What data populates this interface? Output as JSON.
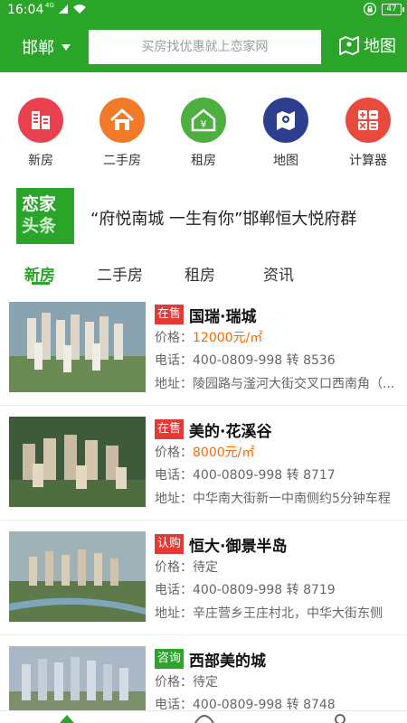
{
  "status_bar": {
    "time": "16:04",
    "network": "4G",
    "battery": "47"
  },
  "header": {
    "city": "邯郸",
    "search_placeholder": "买房找优惠就上恋家网",
    "map_label": "地图"
  },
  "categories": [
    {
      "label": "新房",
      "icon": "building-icon",
      "color": "#e8404f"
    },
    {
      "label": "二手房",
      "icon": "house-icon",
      "color": "#f07a28"
    },
    {
      "label": "租房",
      "icon": "rent-house-icon",
      "color": "#4caf3f"
    },
    {
      "label": "地图",
      "icon": "map-pin-icon",
      "color": "#2d3e8f"
    },
    {
      "label": "计算器",
      "icon": "calculator-icon",
      "color": "#e84a3d"
    }
  ],
  "headline": {
    "logo_line1": "恋家",
    "logo_line2": "头条",
    "text": "“府悦南城 一生有你”邯郸恒大悦府群"
  },
  "tabs": [
    {
      "label": "新房",
      "active": true
    },
    {
      "label": "二手房",
      "active": false
    },
    {
      "label": "租房",
      "active": false
    },
    {
      "label": "资讯",
      "active": false
    }
  ],
  "listings": [
    {
      "status": "在售",
      "status_color": "#e53935",
      "name": "国瑞·瑞城",
      "price_label": "价格：",
      "price": "12000元/㎡",
      "phone": "电话：400-0809-998 转 8536",
      "address": "地址：陵园路与滏河大街交叉口西南角（..."
    },
    {
      "status": "在售",
      "status_color": "#e53935",
      "name": "美的·花溪谷",
      "price_label": "价格：",
      "price": "8000元/㎡",
      "phone": "电话：400-0809-998 转 8717",
      "address": "地址：中华南大街新一中南侧约5分钟车程"
    },
    {
      "status": "认购",
      "status_color": "#e53935",
      "name": "恒大·御景半岛",
      "price_label": "价格：",
      "price": "待定",
      "phone": "电话：400-0809-998 转 8719",
      "address": "地址：辛庄营乡王庄村北，中华大街东侧"
    },
    {
      "status": "咨询",
      "status_color": "#2aa52a",
      "name": "西部美的城",
      "price_label": "价格：",
      "price": "待定",
      "phone": "电话：400-0809-998 转 8748",
      "address": ""
    }
  ]
}
